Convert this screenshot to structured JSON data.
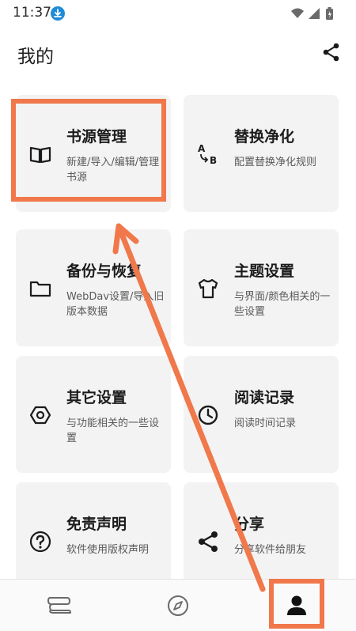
{
  "status_bar": {
    "time": "11:37",
    "icons": [
      "download-icon",
      "wifi-icon",
      "signal-icon",
      "battery-icon"
    ]
  },
  "app_bar": {
    "title": "我的",
    "share_icon": "share-icon"
  },
  "cards": [
    {
      "id": "book-source",
      "title": "书源管理",
      "desc": "新建/导入/编辑/管理书源",
      "icon": "book-icon"
    },
    {
      "id": "replace",
      "title": "替换净化",
      "desc": "配置替换净化规则",
      "icon": "replace-ab-icon"
    },
    {
      "id": "backup",
      "title": "备份与恢复",
      "desc": "WebDav设置/导入旧版本数据",
      "icon": "folder-icon"
    },
    {
      "id": "theme",
      "title": "主题设置",
      "desc": "与界面/颜色相关的一些设置",
      "icon": "tshirt-icon"
    },
    {
      "id": "other",
      "title": "其它设置",
      "desc": "与功能相关的一些设置",
      "icon": "hexagon-settings-icon"
    },
    {
      "id": "reading-log",
      "title": "阅读记录",
      "desc": "阅读时间记录",
      "icon": "clock-icon"
    },
    {
      "id": "disclaimer",
      "title": "免责声明",
      "desc": "软件使用版权声明",
      "icon": "question-icon"
    },
    {
      "id": "share",
      "title": "分享",
      "desc": "分享软件给朋友",
      "icon": "share-icon"
    }
  ],
  "bottom_nav": {
    "items": [
      {
        "id": "bookshelf",
        "icon": "bookshelf-icon",
        "active": false
      },
      {
        "id": "discover",
        "icon": "compass-icon",
        "active": false
      },
      {
        "id": "mine",
        "icon": "person-icon",
        "active": true
      }
    ]
  },
  "colors": {
    "accent_annotation": "#f0784a",
    "card_bg": "#f3f3f3",
    "download_badge": "#1e8bd8"
  }
}
